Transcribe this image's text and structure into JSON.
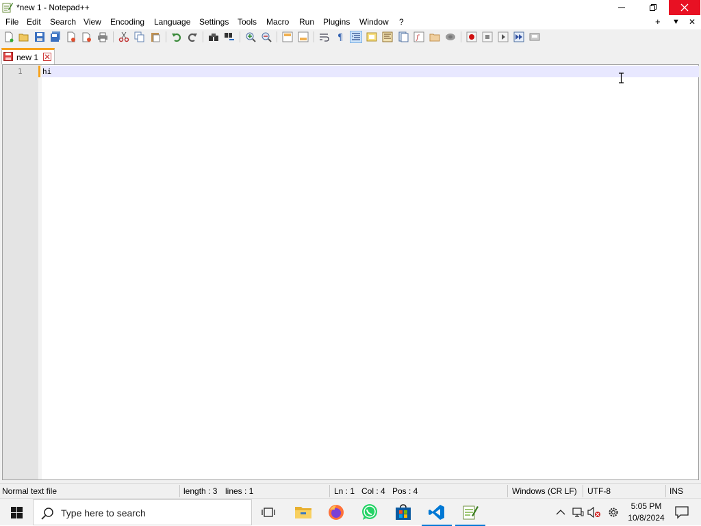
{
  "window": {
    "title": "*new 1 - Notepad++"
  },
  "menu": {
    "items": [
      "File",
      "Edit",
      "Search",
      "View",
      "Encoding",
      "Language",
      "Settings",
      "Tools",
      "Macro",
      "Run",
      "Plugins",
      "Window",
      "?"
    ],
    "right": {
      "add": "+",
      "dropdown": "▼",
      "close": "✕"
    }
  },
  "tabs": [
    {
      "label": "new 1",
      "modified": true
    }
  ],
  "editor": {
    "line_numbers": [
      "1"
    ],
    "lines": [
      "hi"
    ]
  },
  "status": {
    "file_type": "Normal text file",
    "length": "length : 3",
    "lines": "lines : 1",
    "ln": "Ln : 1",
    "col": "Col : 4",
    "pos": "Pos : 4",
    "eol": "Windows (CR LF)",
    "encoding": "UTF-8",
    "mode": "INS"
  },
  "taskbar": {
    "search_placeholder": "Type here to search",
    "time": "5:05 PM",
    "date": "10/8/2024",
    "apps": [
      "task-view",
      "file-explorer",
      "firefox",
      "whatsapp",
      "microsoft-store",
      "vscode",
      "notepad-plus-plus"
    ]
  },
  "colors": {
    "accent_tab": "#f7a21b",
    "close_red": "#e81123",
    "caret_line": "#e8e8ff",
    "taskbar_active": "#0078d7"
  }
}
